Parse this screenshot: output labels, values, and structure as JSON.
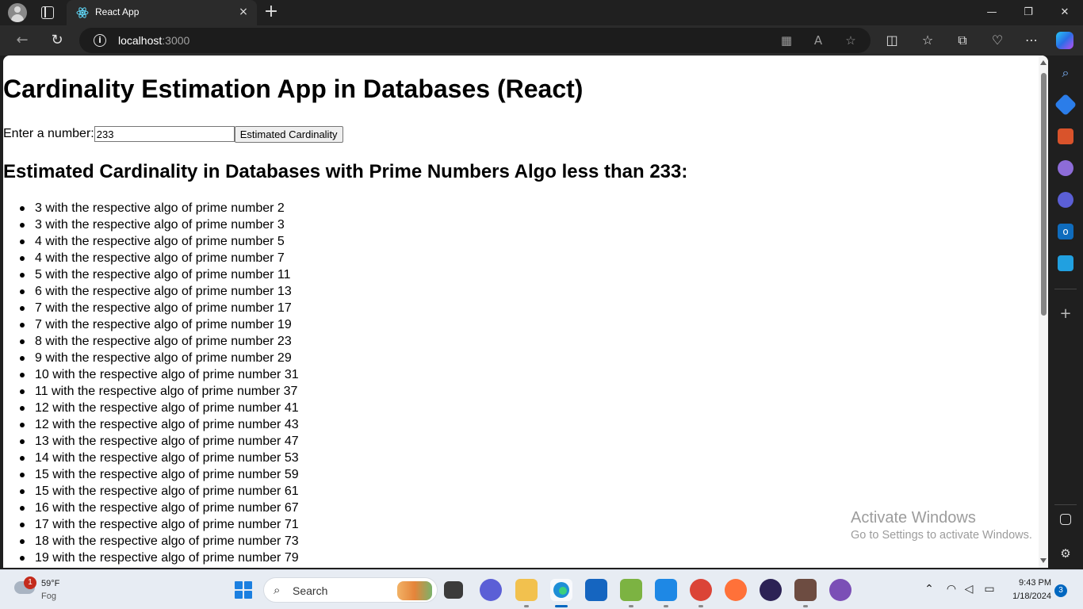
{
  "browser": {
    "tab_title": "React App",
    "url_host": "localhost",
    "url_port": ":3000"
  },
  "page": {
    "heading": "Cardinality Estimation App in Databases (React)",
    "input_label": "Enter a number:",
    "input_value": "233",
    "button_label": "Estimated Cardinality",
    "results_heading": "Estimated Cardinality in Databases with Prime Numbers Algo less than 233:",
    "results": [
      "3 with the respective algo of prime number 2",
      "3 with the respective algo of prime number 3",
      "4 with the respective algo of prime number 5",
      "4 with the respective algo of prime number 7",
      "5 with the respective algo of prime number 11",
      "6 with the respective algo of prime number 13",
      "7 with the respective algo of prime number 17",
      "7 with the respective algo of prime number 19",
      "8 with the respective algo of prime number 23",
      "9 with the respective algo of prime number 29",
      "10 with the respective algo of prime number 31",
      "11 with the respective algo of prime number 37",
      "12 with the respective algo of prime number 41",
      "12 with the respective algo of prime number 43",
      "13 with the respective algo of prime number 47",
      "14 with the respective algo of prime number 53",
      "15 with the respective algo of prime number 59",
      "15 with the respective algo of prime number 61",
      "16 with the respective algo of prime number 67",
      "17 with the respective algo of prime number 71",
      "18 with the respective algo of prime number 73",
      "19 with the respective algo of prime number 79"
    ]
  },
  "watermark": {
    "title": "Activate Windows",
    "subtitle": "Go to Settings to activate Windows."
  },
  "taskbar": {
    "weather_badge": "1",
    "temperature": "59°F",
    "condition": "Fog",
    "search_label": "Search",
    "time": "9:43 PM",
    "date": "1/18/2024",
    "notification_count": "3"
  },
  "icons": {
    "tab_close": "×",
    "new_tab": "+",
    "minimize": "—",
    "maximize": "❐",
    "close": "✕",
    "back": "←",
    "refresh": "↻",
    "more": "⋯",
    "sidebar_add": "+"
  },
  "colors": {
    "browser_frame": "#202020",
    "toolbar": "#2b2b2b",
    "omnibox": "#1c1c1c",
    "taskbar": "#e7ecf3",
    "accent": "#0067c0"
  }
}
